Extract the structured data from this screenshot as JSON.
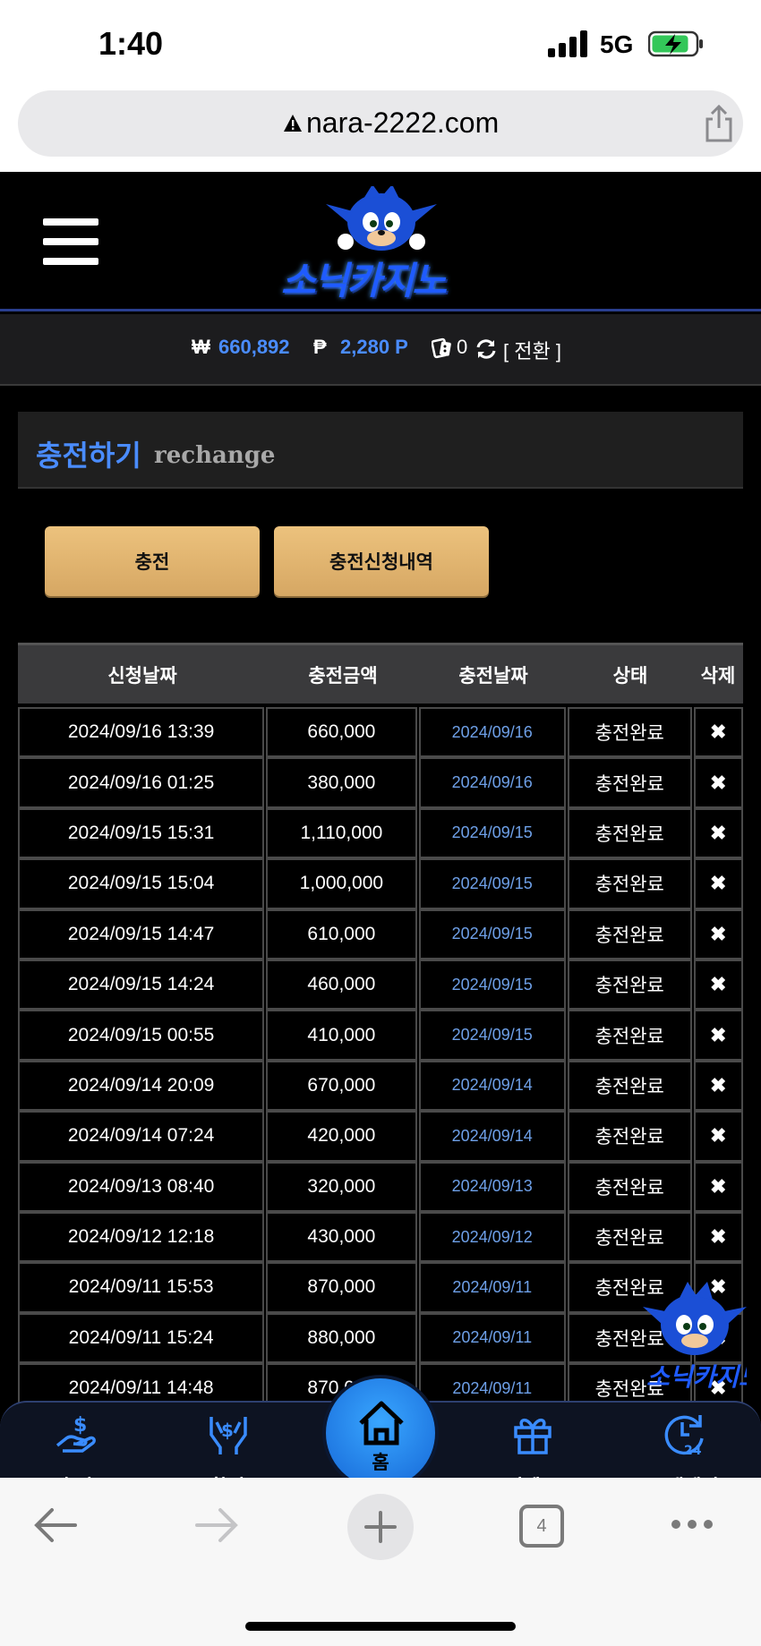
{
  "status_bar": {
    "time": "1:40",
    "network": "5G"
  },
  "browser": {
    "url": "nara-2222.com",
    "open_tabs": "4"
  },
  "site": {
    "logo_text": "소닉카지노"
  },
  "balance": {
    "won_symbol": "₩",
    "won_value": "660,892",
    "point_symbol": "₱",
    "point_value": "2,280 P",
    "chip_value": "0",
    "switch_label": "[ 전환 ]"
  },
  "section": {
    "title_ko": "충전하기",
    "title_en": "rechange"
  },
  "buttons": {
    "charge": "충전",
    "history": "충전신청내역"
  },
  "table": {
    "headers": [
      "신청날짜",
      "충전금액",
      "충전날짜",
      "상태",
      "삭제"
    ],
    "rows": [
      {
        "requested": "2024/09/16 13:39",
        "amount": "660,000",
        "charged": "2024/09/16",
        "status": "충전완료"
      },
      {
        "requested": "2024/09/16 01:25",
        "amount": "380,000",
        "charged": "2024/09/16",
        "status": "충전완료"
      },
      {
        "requested": "2024/09/15 15:31",
        "amount": "1,110,000",
        "charged": "2024/09/15",
        "status": "충전완료"
      },
      {
        "requested": "2024/09/15 15:04",
        "amount": "1,000,000",
        "charged": "2024/09/15",
        "status": "충전완료"
      },
      {
        "requested": "2024/09/15 14:47",
        "amount": "610,000",
        "charged": "2024/09/15",
        "status": "충전완료"
      },
      {
        "requested": "2024/09/15 14:24",
        "amount": "460,000",
        "charged": "2024/09/15",
        "status": "충전완료"
      },
      {
        "requested": "2024/09/15 00:55",
        "amount": "410,000",
        "charged": "2024/09/15",
        "status": "충전완료"
      },
      {
        "requested": "2024/09/14 20:09",
        "amount": "670,000",
        "charged": "2024/09/14",
        "status": "충전완료"
      },
      {
        "requested": "2024/09/14 07:24",
        "amount": "420,000",
        "charged": "2024/09/14",
        "status": "충전완료"
      },
      {
        "requested": "2024/09/13 08:40",
        "amount": "320,000",
        "charged": "2024/09/13",
        "status": "충전완료"
      },
      {
        "requested": "2024/09/12 12:18",
        "amount": "430,000",
        "charged": "2024/09/12",
        "status": "충전완료"
      },
      {
        "requested": "2024/09/11 15:53",
        "amount": "870,000",
        "charged": "2024/09/11",
        "status": "충전완료"
      },
      {
        "requested": "2024/09/11 15:24",
        "amount": "880,000",
        "charged": "2024/09/11",
        "status": "충전완료"
      },
      {
        "requested": "2024/09/11 14:48",
        "amount": "870,000",
        "charged": "2024/09/11",
        "status": "충전완료"
      }
    ],
    "delete_symbol": "✖"
  },
  "bottom_nav": {
    "charge": "충전",
    "exchange": "환전",
    "home": "홈",
    "event": "이벤트",
    "support": "고객센터"
  },
  "colors": {
    "accent_blue": "#4a8cff",
    "button_gold": "#e2b470",
    "nav_home": "#2a8bf2"
  }
}
